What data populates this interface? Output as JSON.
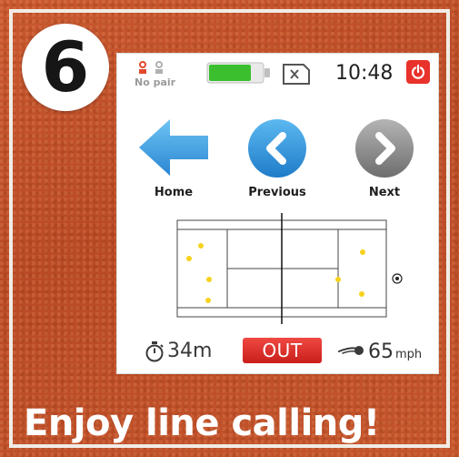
{
  "step": {
    "number": "6"
  },
  "status": {
    "pair_label": "No pair",
    "time": "10:48",
    "battery_level": 0.8
  },
  "nav": {
    "home_label": "Home",
    "previous_label": "Previous",
    "next_label": "Next"
  },
  "court": {
    "ball_marks": 7,
    "call": "OUT"
  },
  "stats": {
    "duration": "34m",
    "speed": "65",
    "speed_unit": "mph"
  },
  "tagline": "Enjoy line calling!",
  "colors": {
    "background": "#c1532d",
    "nav_blue": "#2b8fd8",
    "nav_gray": "#8c8c8c",
    "battery_green": "#3bbf2f",
    "out_red": "#e0302a",
    "ball_yellow": "#f7d21e"
  },
  "icons": {
    "power": "power-icon",
    "home": "arrow-left-icon",
    "previous": "chevron-left-icon",
    "next": "chevron-right-icon",
    "timer": "stopwatch-icon",
    "speed": "ball-trail-icon",
    "card": "card-x-icon"
  }
}
